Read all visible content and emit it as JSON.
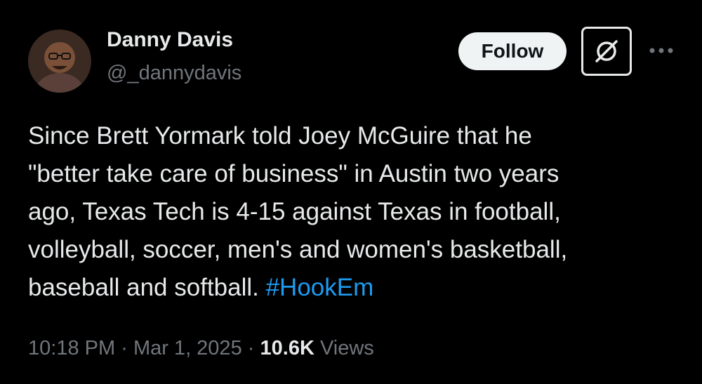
{
  "author": {
    "name": "Danny Davis",
    "handle": "@_dannydavis"
  },
  "actions": {
    "follow_label": "Follow",
    "grok_icon": "grok-icon",
    "more_icon": "more-icon"
  },
  "tweet": {
    "text": "Since Brett Yormark told Joey McGuire that he\n\"better take care of business\" in Austin two years\nago, Texas Tech is 4-15 against Texas in football,\nvolleyball, soccer, men's and women's basketball,\nbaseball and softball.",
    "hashtag": "#HookEm"
  },
  "meta": {
    "time": "10:18 PM",
    "separator": "·",
    "date": "Mar 1, 2025",
    "views_count": "10.6K",
    "views_label": "Views"
  },
  "colors": {
    "background": "#000000",
    "text": "#e7e9ea",
    "secondary": "#71767b",
    "link": "#1d9bf0"
  }
}
